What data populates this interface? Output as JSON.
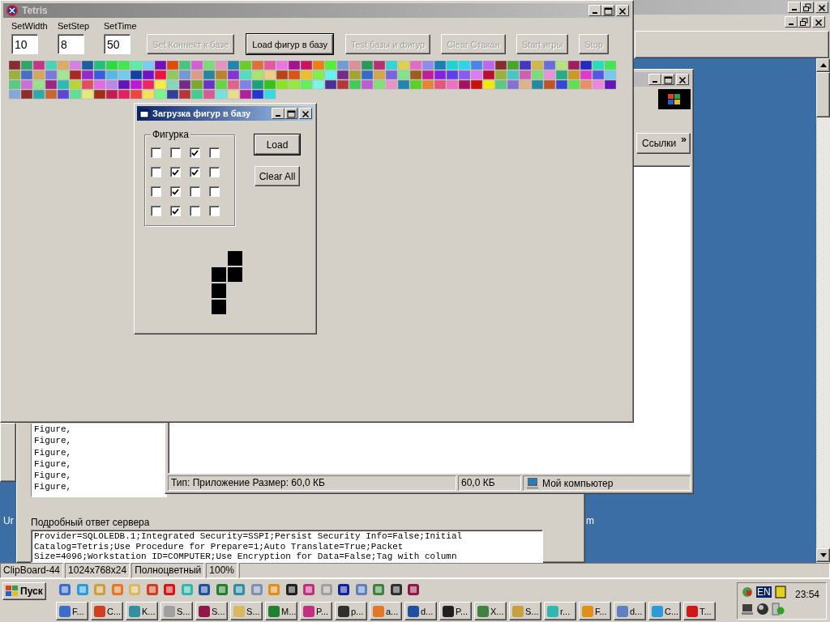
{
  "tetris_window": {
    "title": "Tetris",
    "fields": [
      {
        "label": "SetWidth",
        "value": "10"
      },
      {
        "label": "SetStep",
        "value": "8"
      },
      {
        "label": "SetTime",
        "value": "50"
      }
    ],
    "buttons": [
      {
        "label": "Set Коннект к базе",
        "disabled": true,
        "default": false
      },
      {
        "label": "Load фигур в базу",
        "disabled": false,
        "default": true
      },
      {
        "label": "Test базы и фигур",
        "disabled": true,
        "default": false
      },
      {
        "label": "Clear Стакан",
        "disabled": true,
        "default": false
      },
      {
        "label": "Start игры",
        "disabled": true,
        "default": false
      },
      {
        "label": "Stop",
        "disabled": true,
        "default": false
      }
    ]
  },
  "load_dialog": {
    "title": "Загрузка фигур в базу",
    "group_label": "Фигурка",
    "grid": [
      {
        "cells": [
          {
            "checked": false
          },
          {
            "checked": false
          },
          {
            "checked": true
          },
          {
            "checked": false
          }
        ]
      },
      {
        "cells": [
          {
            "checked": false
          },
          {
            "checked": true
          },
          {
            "checked": true
          },
          {
            "checked": false
          }
        ]
      },
      {
        "cells": [
          {
            "checked": false
          },
          {
            "checked": true
          },
          {
            "checked": false
          },
          {
            "checked": false
          }
        ]
      },
      {
        "cells": [
          {
            "checked": false
          },
          {
            "checked": true
          },
          {
            "checked": false
          },
          {
            "checked": false
          }
        ]
      }
    ],
    "buttons": [
      {
        "label": "Load",
        "default": true
      },
      {
        "label": "Clear All",
        "default": false
      }
    ]
  },
  "explorer_window": {
    "links_label": "Ссылки",
    "links_chevron": "»",
    "status": [
      "Тип: Приложение Размер: 60,0 КБ",
      "60,0 КБ",
      "Мой компьютер"
    ]
  },
  "query_window": {
    "list_lines": [
      "Figure,",
      "Figure,",
      "Figure,",
      "Figure,",
      "Figure,",
      "Figure,"
    ],
    "response_label": "Подробный ответ сервера",
    "response_text": "Provider=SQLOLEDB.1;Integrated Security=SSPI;Persist Security Info=False;Initial Catalog=Tetris;Use Procedure for Prepare=1;Auto Translate=True;Packet Size=4096;Workstation ID=COMPUTER;Use Encryption for Data=False;Tag with column"
  },
  "desktop_texts": [
    "Ur",
    "m"
  ],
  "status_bar": [
    "ClipBoard-44",
    "1024x768x24",
    "Полноцветный",
    "100%"
  ],
  "taskbar": {
    "start_label": "Пуск",
    "tasks": [
      "F...",
      "C...",
      "K...",
      "S...",
      "S...",
      "S...",
      "M...",
      "P...",
      "p...",
      "a...",
      "d...",
      "P...",
      "X...",
      "S...",
      "r...",
      "F...",
      "d...",
      "C...",
      "T..."
    ],
    "tray": {
      "language": "EN",
      "clock": "23:54"
    }
  }
}
